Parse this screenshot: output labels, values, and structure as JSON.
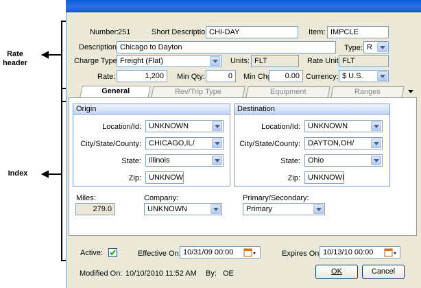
{
  "annotations": {
    "rate_header": "Rate\nheader",
    "index": "Index"
  },
  "header": {
    "number_label": "Number:",
    "number_value": "251",
    "short_desc_label": "Short Description:",
    "short_desc_value": "CHI-DAY",
    "item_label": "Item:",
    "item_value": "IMPCLE",
    "description_label": "Description:",
    "description_value": "Chicago to Dayton",
    "type_label": "Type:",
    "type_value": "R",
    "charge_type_label": "Charge Type:",
    "charge_type_value": "Freight (Flat)",
    "units_label": "Units:",
    "units_value": "FLT",
    "rate_unit_label": "Rate Unit:",
    "rate_unit_value": "FLT",
    "rate_label": "Rate:",
    "rate_value": "1,200",
    "min_qty_label": "Min Qty:",
    "min_qty_value": "0",
    "min_chg_label": "Min Chg:",
    "min_chg_value": "0.00",
    "currency_label": "Currency:",
    "currency_value": "$ U.S."
  },
  "tabs": [
    {
      "label": "General",
      "active": true
    },
    {
      "label": "Rev/Trip Type",
      "active": false
    },
    {
      "label": "Equipment",
      "active": false
    },
    {
      "label": "Ranges",
      "active": false
    }
  ],
  "origin": {
    "title": "Origin",
    "location_label": "Location/Id:",
    "location_value": "UNKNOWN",
    "city_label": "City/State/County:",
    "city_value": "CHICAGO,IL/",
    "state_label": "State:",
    "state_value": "Illinois",
    "zip_label": "Zip:",
    "zip_value": "UNKNOWN"
  },
  "destination": {
    "title": "Destination",
    "location_label": "Location/Id:",
    "location_value": "UNKNOWN",
    "city_label": "City/State/County:",
    "city_value": "DAYTON,OH/",
    "state_label": "State:",
    "state_value": "Ohio",
    "zip_label": "Zip:",
    "zip_value": "UNKNOWN"
  },
  "misc": {
    "miles_label": "Miles:",
    "miles_value": "279.0",
    "company_label": "Company:",
    "company_value": "UNKNOWN",
    "primary_label": "Primary/Secondary:",
    "primary_value": "Primary"
  },
  "footer": {
    "active_label": "Active:",
    "active_checked": true,
    "effective_label": "Effective On:",
    "effective_value": "10/31/09 00:00",
    "expires_label": "Expires On:",
    "expires_value": "10/13/10 00:00",
    "modified_label": "Modified On:",
    "modified_value": "10/10/2010 11:52 AM",
    "by_label": "By:",
    "by_value": "OE",
    "ok_label": "OK",
    "cancel_label": "Cancel"
  },
  "colors": {
    "dialog_bg": "#ece9d8",
    "titlebar": "#2a72e6",
    "group_border": "#7a96df",
    "field_border": "#7f9db9"
  }
}
